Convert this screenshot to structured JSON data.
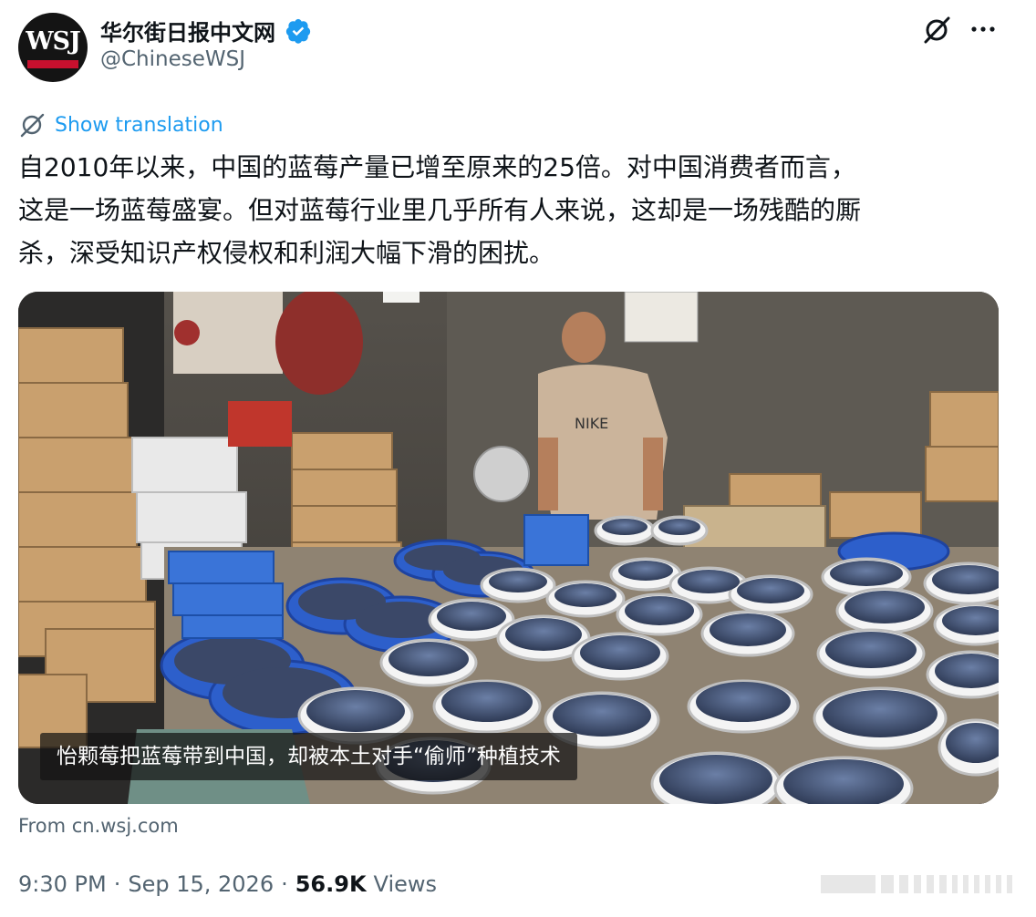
{
  "header": {
    "avatar_text": "WSJ",
    "display_name": "华尔街日报中文网",
    "handle": "@ChineseWSJ",
    "verified_color": "#1d9bf0"
  },
  "translate": {
    "label": "Show translation"
  },
  "tweet": {
    "text": "自2010年以来，中国的蓝莓产量已增至原来的25倍。对中国消费者而言，\n这是一场蓝莓盛宴。但对蓝莓行业里几乎所有人来说，这却是一场残酷的厮\n杀，深受知识产权侵权和利润大幅下滑的困扰。"
  },
  "media": {
    "caption": "怡颗莓把蓝莓带到中国，却被本土对手“偷师”种植技术",
    "shirt_brand": "NIKE"
  },
  "source": {
    "label": "From cn.wsj.com"
  },
  "meta": {
    "time": "9:30 PM",
    "separator": "·",
    "date": "Sep 15, 2026",
    "views_count": "56.9K",
    "views_label": "Views"
  },
  "colors": {
    "link": "#1d9bf0",
    "muted": "#536471",
    "text": "#0f1419"
  },
  "icons": [
    "verified-badge-icon",
    "grok-icon",
    "more-options-icon",
    "translate-icon"
  ]
}
